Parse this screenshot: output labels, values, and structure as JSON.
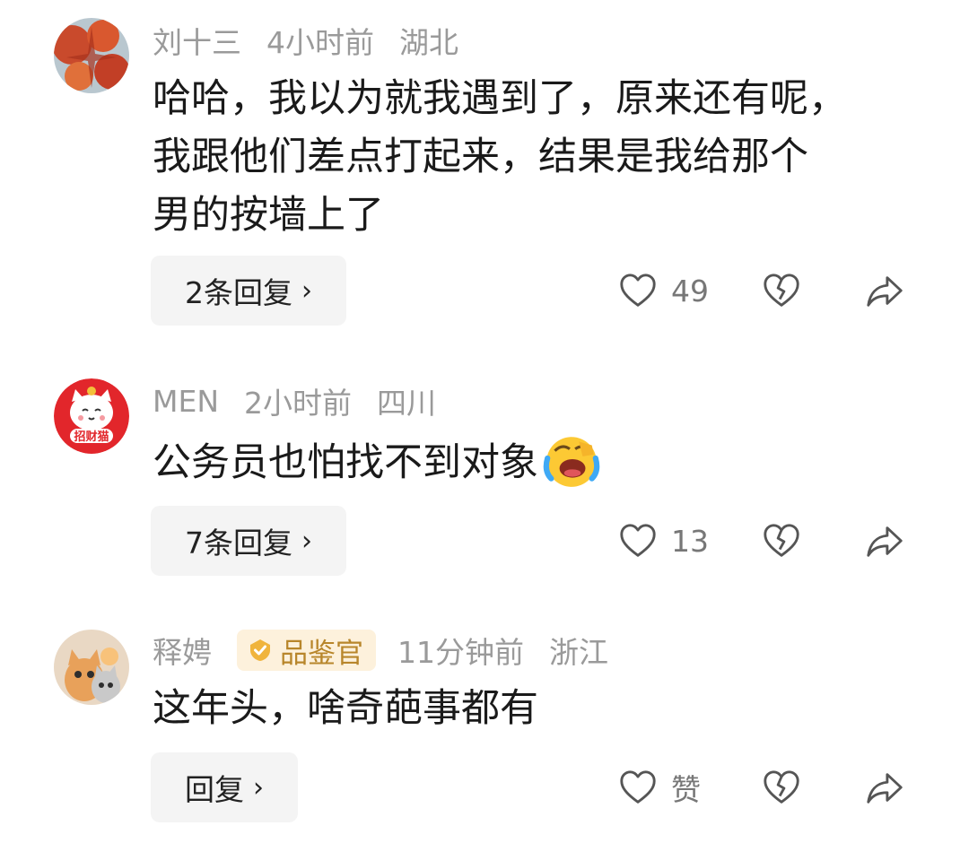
{
  "comments": [
    {
      "username": "刘十三",
      "badge": "",
      "time": "4小时前",
      "location": "湖北",
      "lines": [
        "哈哈，我以为就我遇到了，原来还有呢，",
        "我跟他们差点打起来，结果是我给那个",
        "男的按墙上了"
      ],
      "reply_label": "2条回复",
      "likes": "49",
      "avatar_icon": "red-maple-leaves-avatar"
    },
    {
      "username": "MEN",
      "badge": "",
      "time": "2小时前",
      "location": "四川",
      "lines": [
        "公务员也怕找不到对象"
      ],
      "emoji": "rolling-laughing-emoji",
      "reply_label": "7条回复",
      "likes": "13",
      "avatar_icon": "lucky-cat-avatar",
      "avatar_text": "招财猫"
    },
    {
      "username": "释娉",
      "badge": "品鉴官",
      "time": "11分钟前",
      "location": "浙江",
      "lines": [
        "这年头，啥奇葩事都有"
      ],
      "reply_label": "回复",
      "likes": "赞",
      "avatar_icon": "kittens-avatar"
    }
  ],
  "icons": {
    "like": "heart-outline-icon",
    "dislike": "broken-heart-icon",
    "share": "share-arrow-icon",
    "chevron": "›"
  },
  "colors": {
    "meta": "#9a9a9a",
    "text": "#1a1a1a",
    "badge_bg": "#fdf1dc",
    "badge_text": "#b8862b",
    "reply_bg": "#f4f4f4"
  }
}
